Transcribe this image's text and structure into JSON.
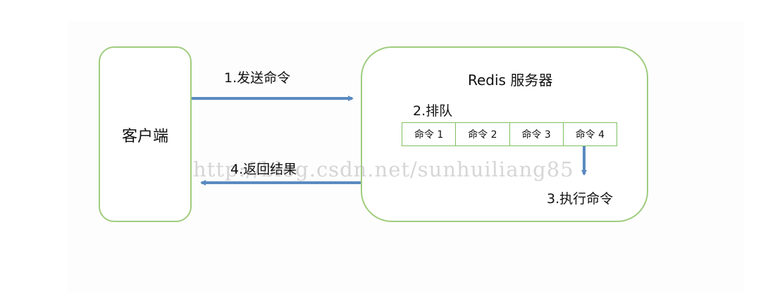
{
  "nodes": {
    "client": {
      "label": "客户端"
    },
    "server": {
      "title": "Redis 服务器"
    }
  },
  "steps": {
    "send": "1.发送命令",
    "queue": "2.排队",
    "execute": "3.执行命令",
    "return": "4.返回结果"
  },
  "queue_items": [
    "命令 1",
    "命令 2",
    "命令 3",
    "命令 4"
  ],
  "watermark": "http://blog.csdn.net/sunhuiliang85",
  "colors": {
    "box_border": "#9fcc7e",
    "arrow": "#5a8ac0",
    "queue_border": "#7fbf5f"
  }
}
